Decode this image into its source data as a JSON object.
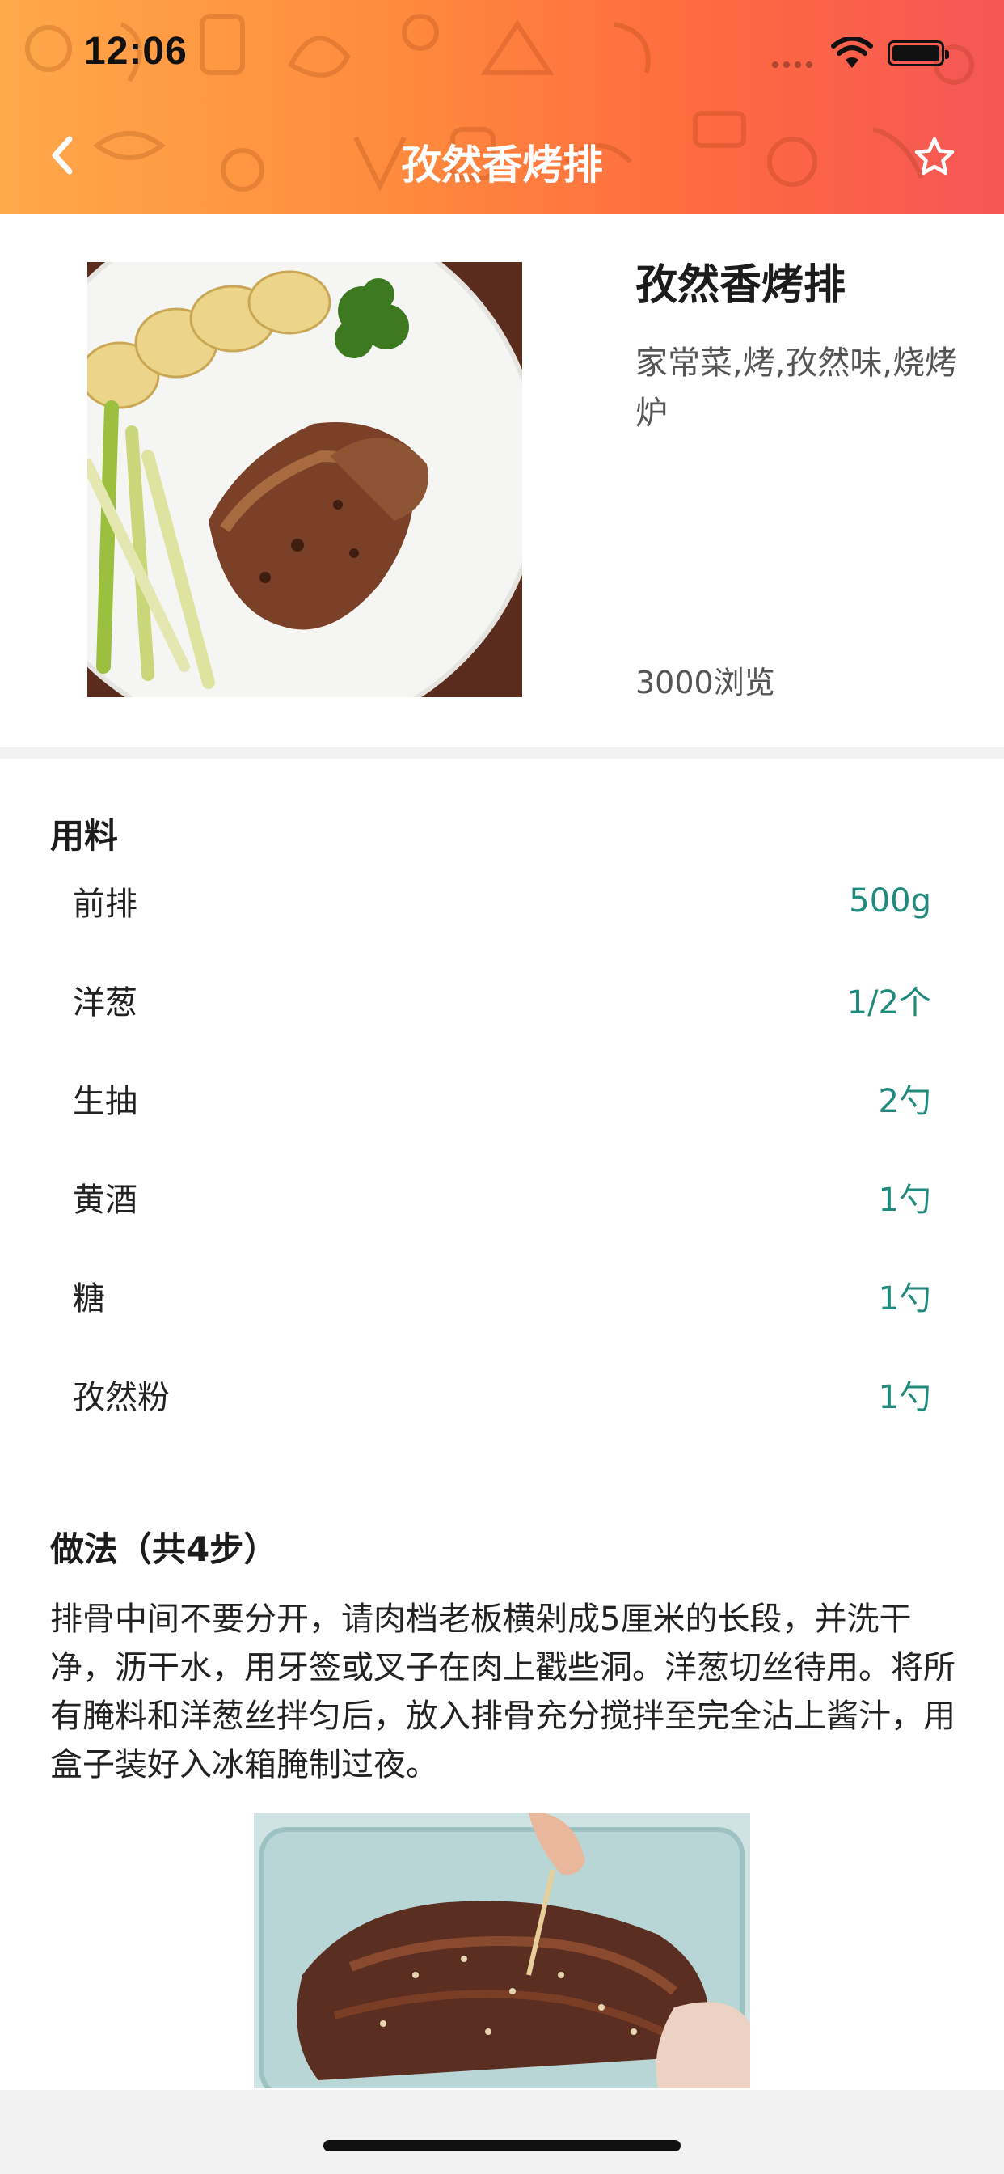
{
  "status_bar": {
    "time": "12:06"
  },
  "nav": {
    "title": "孜然香烤排",
    "back_icon": "chevron-left-icon",
    "favorite_icon": "star-outline-icon"
  },
  "summary": {
    "name": "孜然香烤排",
    "tags": "家常菜,烤,孜然味,烧烤炉",
    "views": "3000浏览"
  },
  "ingredients": {
    "title": "用料",
    "items": [
      {
        "name": "前排",
        "amount": "500g"
      },
      {
        "name": "洋葱",
        "amount": "1/2个"
      },
      {
        "name": "生抽",
        "amount": "2勺"
      },
      {
        "name": "黄酒",
        "amount": "1勺"
      },
      {
        "name": "糖",
        "amount": "1勺"
      },
      {
        "name": "孜然粉",
        "amount": "1勺"
      }
    ]
  },
  "method": {
    "title": "做法（共4步）",
    "steps": [
      {
        "text": "排骨中间不要分开，请肉档老板横剁成5厘米的长段，并洗干净，沥干水，用牙签或叉子在肉上戳些洞。洋葱切丝待用。将所有腌料和洋葱丝拌匀后，放入排骨充分搅拌至完全沾上酱汁，用盒子装好入冰箱腌制过夜。"
      }
    ]
  },
  "colors": {
    "header_start": "#ffa84a",
    "header_end": "#f55656",
    "amount": "#1f8a7c"
  }
}
